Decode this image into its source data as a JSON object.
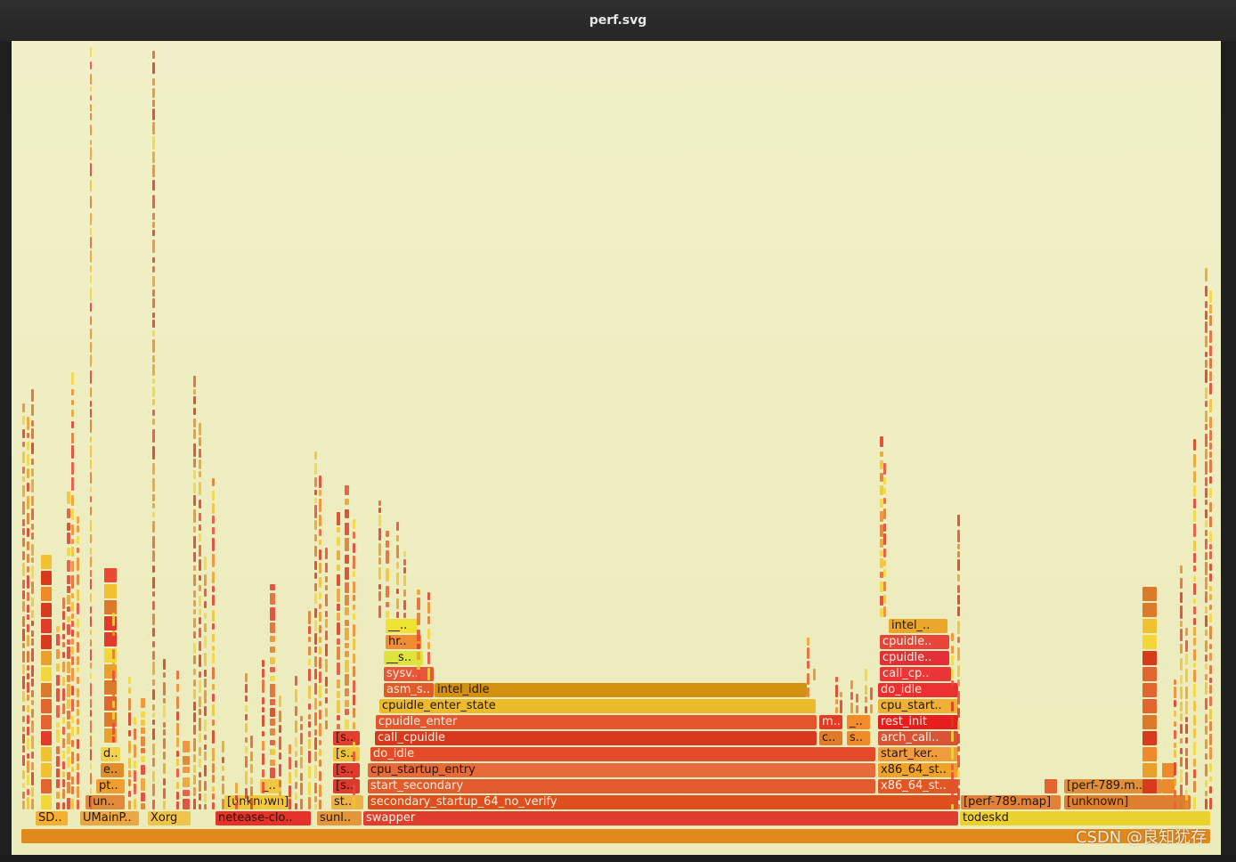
{
  "window": {
    "title": "perf.svg"
  },
  "watermark": "CSDN @良知犹存",
  "colors": {
    "canvas_bg": "#f0efc5",
    "titlebar_bg": "#2b2b2b"
  },
  "frames": {
    "root": "",
    "sd": "SD..",
    "umainp": "UMainP..",
    "xorg": "Xorg",
    "netease": "netease-clo..",
    "sunl": "sunl..",
    "swapper": "swapper",
    "todeskd": "todeskd",
    "un": "[un..",
    "unknown_mid": "[unknown]",
    "st": "st..",
    "secondary_startup": "secondary_startup_64_no_verify",
    "perf_map": "[perf-789.map]",
    "unknown_right": "[unknown]",
    "perf_m": "[perf-789.m..",
    "pt": "pt..",
    "dots_small": "_..",
    "s_a": "[s..",
    "start_secondary": "start_secondary",
    "x86_a": "x86_64_st..",
    "e": "e..",
    "s_b": "[s..",
    "cpu_startup_entry": "cpu_startup_entry",
    "x86_b": "x86_64_st..",
    "d": "d..",
    "s_c": "[s..",
    "do_idle": "do_idle",
    "start_ker": "start_ker..",
    "s_d": "[s..",
    "call_cpuidle": "call_cpuidle",
    "c": "c..",
    "s2": "s..",
    "arch_call": "arch_call..",
    "cpuidle_enter": "cpuidle_enter",
    "m": "m..",
    "us": "_..",
    "rest_init": "rest_init",
    "cpuidle_enter_state": "cpuidle_enter_state",
    "cpu_start": "cpu_start..",
    "asm_s": "asm_s..",
    "intel_idle": "intel_idle",
    "do_idle_r": "do_idle",
    "sysv": "sysv..",
    "call_cp": "call_cp..",
    "us_s": "__s..",
    "cpuidle_a": "cpuidle..",
    "hr": "hr..",
    "cpuidle_b": "cpuidle..",
    "us_dots": "__..",
    "intel_r": "intel_.."
  }
}
